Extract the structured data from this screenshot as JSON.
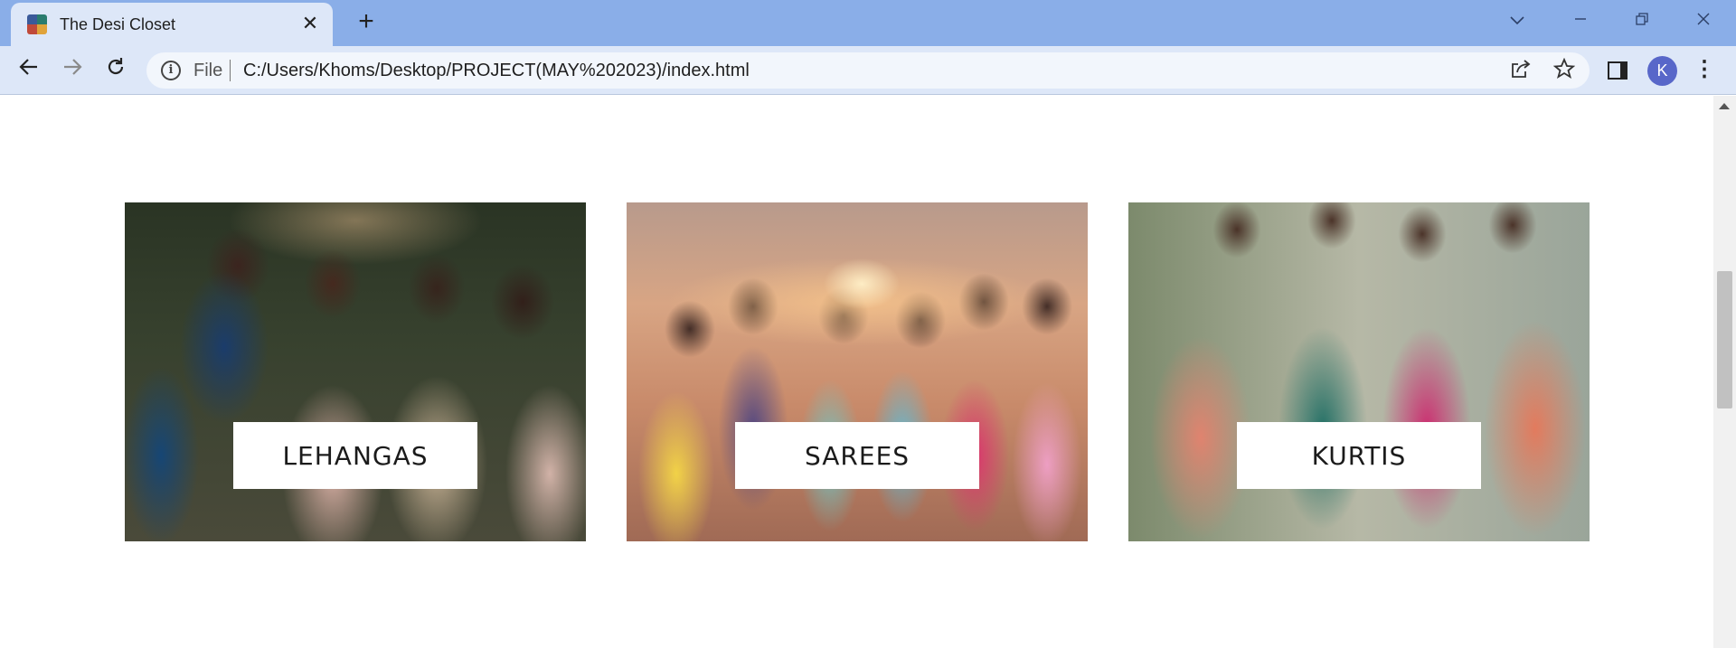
{
  "browser": {
    "tab_title": "The Desi Closet",
    "tab_close": "✕",
    "new_tab": "+",
    "address_scheme": "File",
    "address_url": "C:/Users/Khoms/Desktop/PROJECT(MAY%202023)/index.html",
    "profile_initial": "K"
  },
  "categories": [
    {
      "label": "LEHANGAS"
    },
    {
      "label": "SAREES"
    },
    {
      "label": "KURTIS"
    }
  ]
}
